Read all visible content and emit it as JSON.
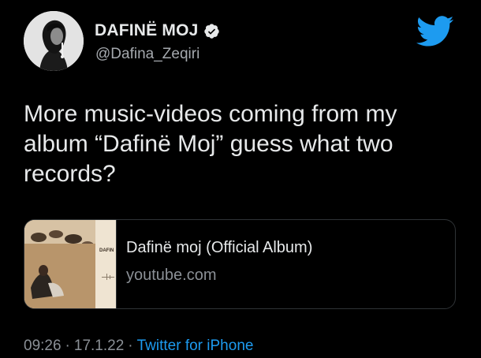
{
  "user": {
    "display_name": "DAFINË MOJ",
    "handle": "@Dafina_Zeqiri",
    "verified": true,
    "avatar_icon": "profile-photo"
  },
  "brand": {
    "icon": "twitter-bird-icon",
    "color": "#1d9bf0"
  },
  "tweet": {
    "text": "More music-videos coming from my\nalbum “Dafinë Moj” guess what two\nrecords?"
  },
  "card": {
    "thumbnail_text": "DAFIN",
    "title": "Dafinë moj (Official Album)",
    "domain": "youtube.com"
  },
  "meta": {
    "time": "09:26",
    "separator_1": "·",
    "date": "17.1.22",
    "separator_2": "·",
    "source": "Twitter for iPhone"
  },
  "colors": {
    "background": "#000000",
    "text": "#e7e9ea",
    "secondary_text": "#8b9096",
    "link": "#1d9bf0",
    "border": "#2f3336"
  }
}
